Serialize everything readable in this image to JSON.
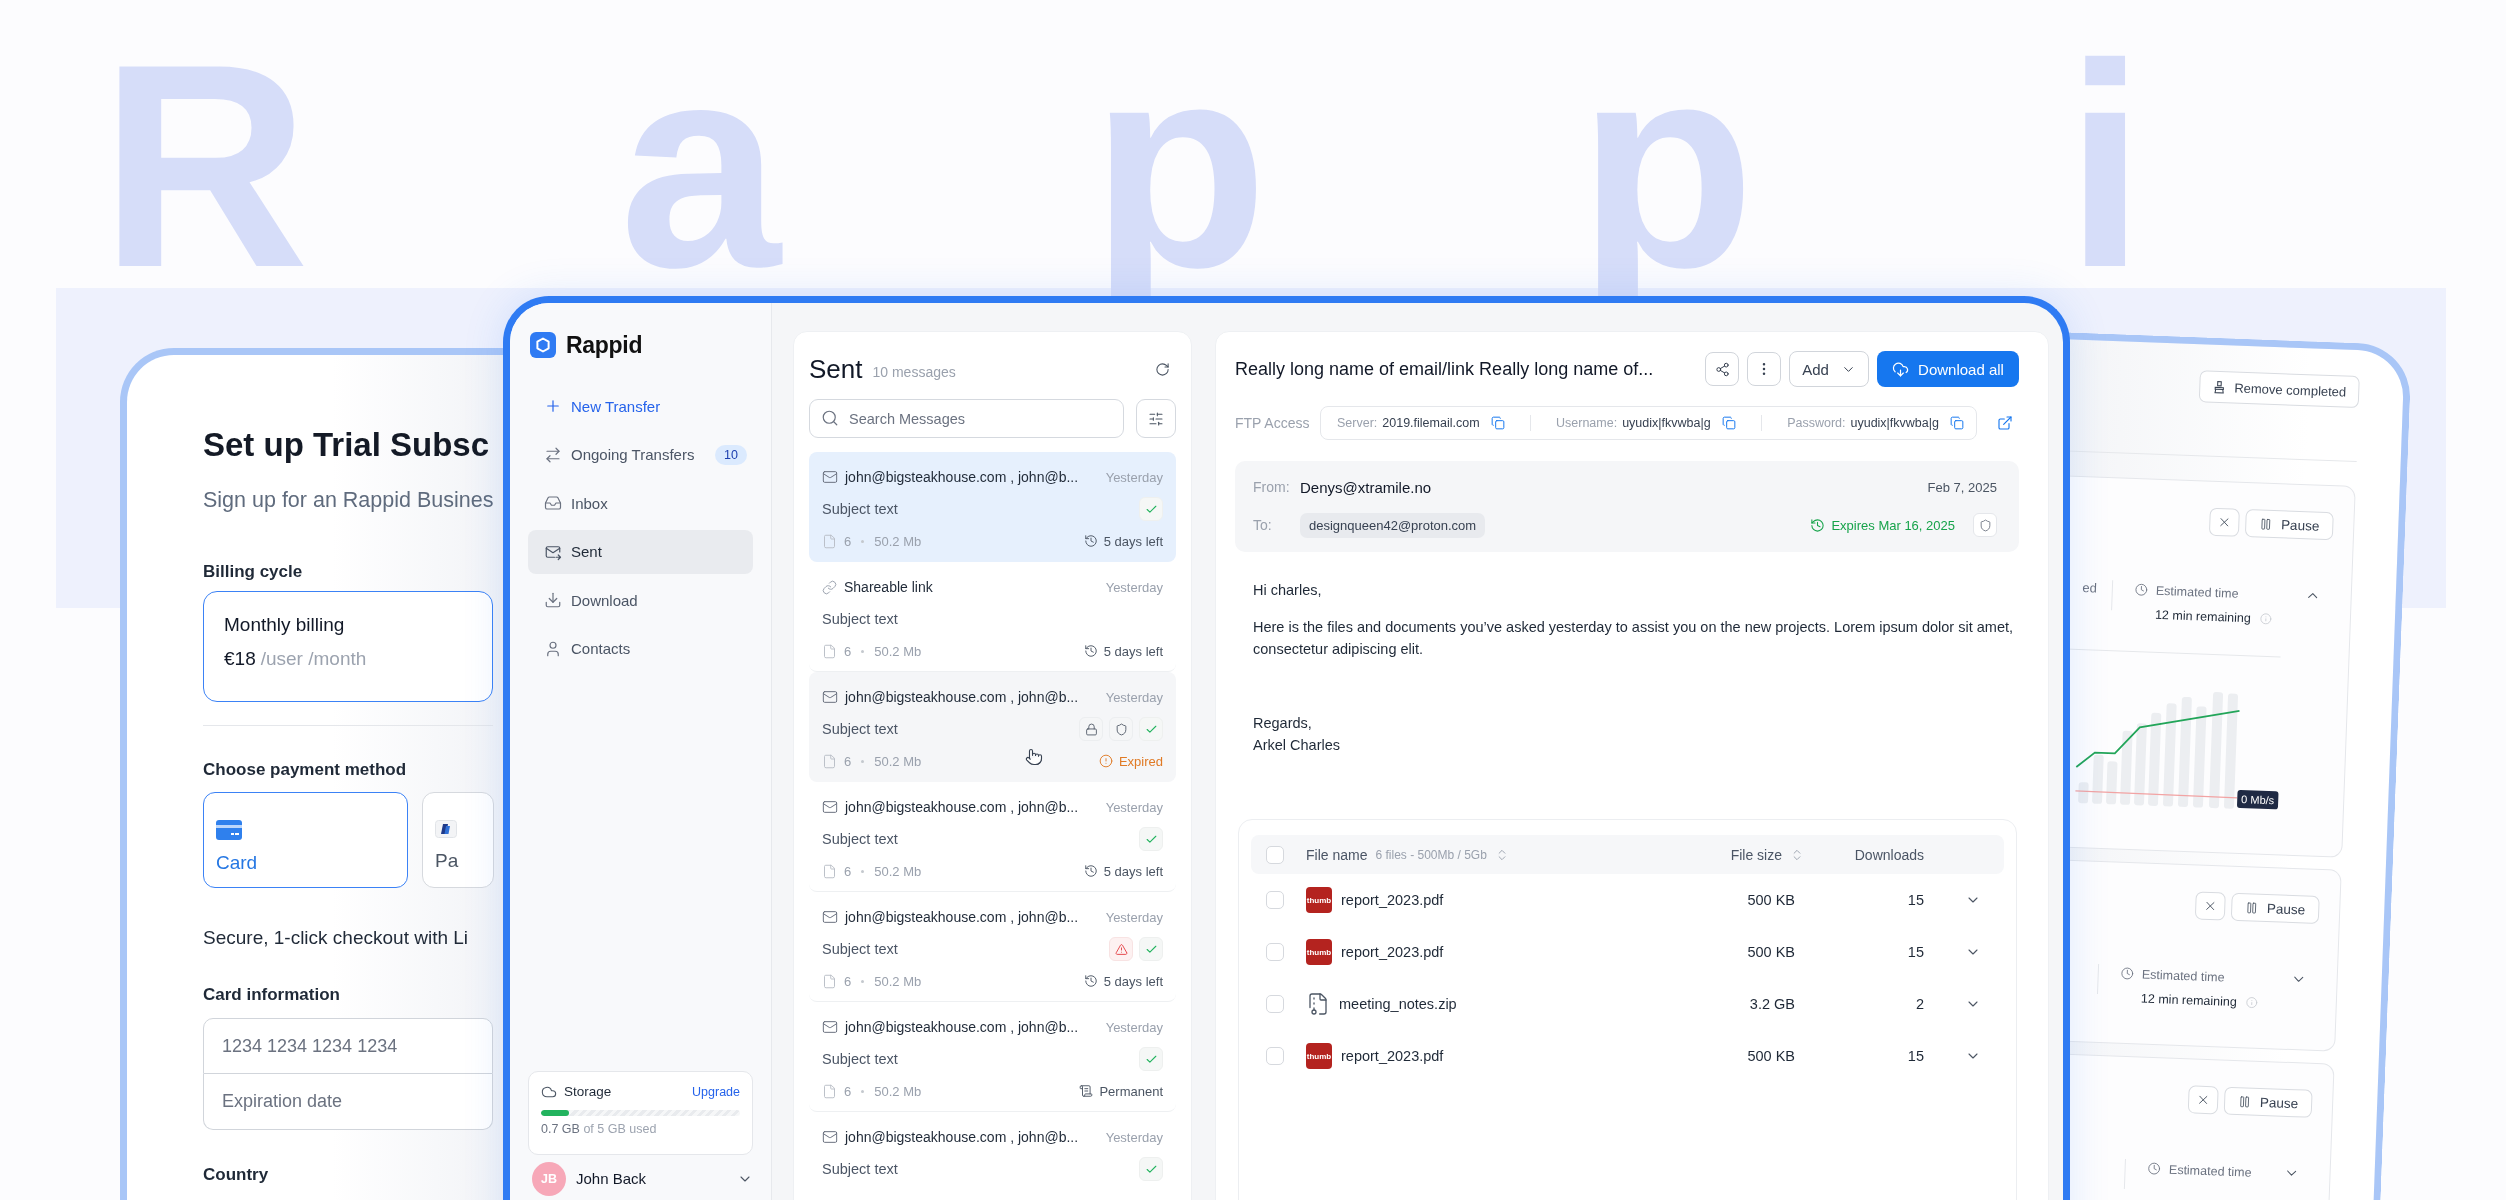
{
  "background": {
    "wordmark": "Rappi"
  },
  "billing": {
    "title": "Set up Trial Subsc",
    "subtitle": "Sign up for an Rappid Busines",
    "cycle_label": "Billing cycle",
    "cycles": [
      {
        "name": "Monthly billing",
        "price": "€18",
        "unit": "/user /month",
        "selected": true
      }
    ],
    "payment_label": "Choose payment method",
    "methods": [
      {
        "kind": "card",
        "label": "Card",
        "selected": true
      },
      {
        "kind": "wallet",
        "label": "Pa",
        "selected": false
      }
    ],
    "checkout_note": "Secure, 1-click checkout with Li",
    "card_label": "Card information",
    "card_fields": [
      {
        "placeholder": "1234 1234 1234 1234"
      },
      {
        "placeholder": "Expiration date"
      }
    ],
    "country_label": "Country"
  },
  "sidebar": {
    "brand": "Rappid",
    "nav": [
      {
        "kind": "create",
        "label": "New Transfer",
        "selected": false
      },
      {
        "kind": "transfers",
        "label": "Ongoing Transfers",
        "badge": "10",
        "selected": false
      },
      {
        "kind": "inbox",
        "label": "Inbox",
        "selected": false
      },
      {
        "kind": "sent",
        "label": "Sent",
        "selected": true
      },
      {
        "kind": "download",
        "label": "Download",
        "selected": false
      },
      {
        "kind": "contacts",
        "label": "Contacts",
        "selected": false
      }
    ],
    "storage": {
      "label": "Storage",
      "link": "Upgrade",
      "level": 0.14,
      "used": "0.7 GB",
      "total": "of 5 GB used"
    },
    "user": {
      "initials": "JB",
      "name": "John Back"
    }
  },
  "messages": {
    "title": "Sent",
    "count": "10 messages",
    "search": {
      "placeholder": "Search Messages"
    },
    "list": [
      {
        "kind": "email",
        "sender": "john@bigsteakhouse.com , john@b...",
        "date": "Yesterday",
        "subject": "Subject text",
        "badges": [
          {
            "kind": "check"
          }
        ],
        "files": "6",
        "size": "50.2 Mb",
        "status": {
          "kind": "countdown",
          "text": "5 days left"
        },
        "selected": true,
        "hovered": false
      },
      {
        "kind": "link",
        "sender": "Shareable link",
        "date": "Yesterday",
        "subject": "Subject text",
        "files": "6",
        "size": "50.2 Mb",
        "status": {
          "kind": "countdown",
          "text": "5 days left"
        },
        "selected": false,
        "hovered": false
      },
      {
        "kind": "email",
        "sender": "john@bigsteakhouse.com , john@b...",
        "date": "Yesterday",
        "subject": "Subject text",
        "badges": [
          {
            "kind": "lock"
          },
          {
            "kind": "shield"
          },
          {
            "kind": "check"
          }
        ],
        "files": "6",
        "size": "50.2 Mb",
        "status": {
          "kind": "expired",
          "text": "Expired"
        },
        "selected": false,
        "hovered": true
      },
      {
        "kind": "email",
        "sender": "john@bigsteakhouse.com , john@b...",
        "date": "Yesterday",
        "subject": "Subject text",
        "badges": [
          {
            "kind": "check"
          }
        ],
        "files": "6",
        "size": "50.2 Mb",
        "status": {
          "kind": "countdown",
          "text": "5 days left"
        },
        "selected": false,
        "hovered": false
      },
      {
        "kind": "email",
        "sender": "john@bigsteakhouse.com , john@b...",
        "date": "Yesterday",
        "subject": "Subject text",
        "badges": [
          {
            "kind": "warning"
          },
          {
            "kind": "check"
          }
        ],
        "files": "6",
        "size": "50.2 Mb",
        "status": {
          "kind": "countdown",
          "text": "5 days left"
        },
        "selected": false,
        "hovered": false
      },
      {
        "kind": "email",
        "sender": "john@bigsteakhouse.com , john@b...",
        "date": "Yesterday",
        "subject": "Subject text",
        "badges": [
          {
            "kind": "check"
          }
        ],
        "files": "6",
        "size": "50.2 Mb",
        "status": {
          "kind": "permanent",
          "text": "Permanent"
        },
        "selected": false,
        "hovered": false
      },
      {
        "kind": "email",
        "sender": "john@bigsteakhouse.com , john@b...",
        "date": "Yesterday",
        "subject": "Subject text",
        "badges": [
          {
            "kind": "check"
          }
        ],
        "selected": false,
        "hovered": false
      }
    ]
  },
  "detail": {
    "title": "Really long name of email/link Really long name of...",
    "tools": [
      {
        "kind": "share"
      },
      {
        "kind": "more"
      }
    ],
    "add": "Add",
    "download": "Download all",
    "ftp": {
      "label": "FTP Access",
      "fields": [
        {
          "label": "Server:",
          "value": "2019.filemail.com"
        },
        {
          "label": "Username:",
          "value": "uyudix|fkvwba|g"
        },
        {
          "label": "Password:",
          "value": "uyudix|fkvwba|g"
        }
      ]
    },
    "from_label": "From:",
    "from": "Denys@xtramile.no",
    "date": "Feb 7, 2025",
    "to_label": "To:",
    "recipients": [
      "designqueen42@proton.com"
    ],
    "expiry": "Expires Mar 16, 2025",
    "body": {
      "greeting": "Hi charles,",
      "paragraph": "Here is the files and documents you’ve asked yesterday to assist you on the new projects. Lorem ipsum dolor sit amet, consectetur adipiscing elit.",
      "closing": "Regards,",
      "signature": "Arkel Charles"
    },
    "files": {
      "select_all": {
        "checked": false
      },
      "columns": [
        {
          "label": "File name",
          "note": "6 files - 500Mb / 5Gb",
          "sortable": true
        },
        {
          "label": "File size",
          "sortable": true
        },
        {
          "label": "Downloads",
          "sortable": false
        }
      ],
      "rows": [
        {
          "kind": "thumb",
          "thumb": "thumb",
          "name": "report_2023.pdf",
          "size": "500 KB",
          "downloads": "15",
          "checked": false,
          "expanded": false
        },
        {
          "kind": "thumb",
          "thumb": "thumb",
          "name": "report_2023.pdf",
          "size": "500 KB",
          "downloads": "15",
          "checked": false,
          "expanded": false
        },
        {
          "kind": "archive",
          "name": "meeting_notes.zip",
          "size": "3.2 GB",
          "downloads": "2",
          "checked": false,
          "expanded": false
        },
        {
          "kind": "thumb",
          "thumb": "thumb",
          "name": "report_2023.pdf",
          "size": "500 KB",
          "downloads": "15",
          "checked": false,
          "expanded": false
        }
      ]
    }
  },
  "transfers": {
    "remove": "Remove completed",
    "items": [
      {
        "expanded": true,
        "status_tail": "ed",
        "pause": "Pause",
        "eta_label": "Estimated time",
        "eta": "12 min remaining",
        "speed": "0 Mb/s"
      },
      {
        "expanded": false,
        "pause": "Pause",
        "eta_label": "Estimated time",
        "eta": "12 min remaining"
      },
      {
        "expanded": false,
        "pause": "Pause",
        "eta_label": "Estimated time"
      }
    ]
  }
}
